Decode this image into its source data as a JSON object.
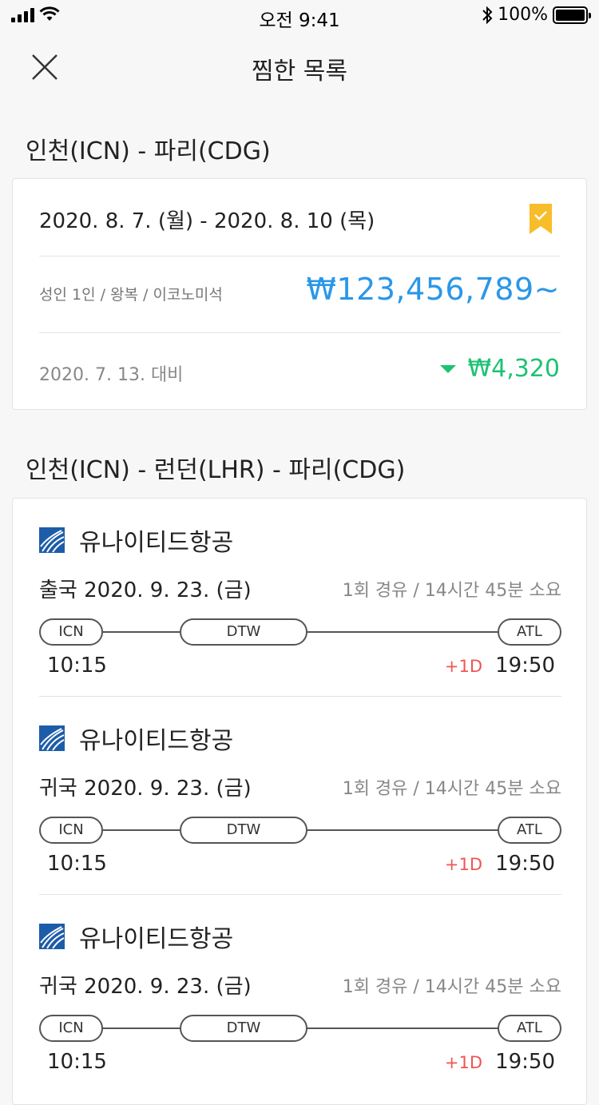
{
  "status_bar": {
    "time": "오전 9:41",
    "battery": "100%"
  },
  "header": {
    "title": "찜한 목록",
    "close_icon": "close-icon"
  },
  "colors": {
    "price_blue": "#2a97e8",
    "drop_green": "#1ec273",
    "bookmark_yellow": "#f7bd2a",
    "plus_day_red": "#f05454",
    "airline_blue": "#1d5ca8"
  },
  "trip1": {
    "route": "인천(ICN) - 파리(CDG)",
    "dates": "2020. 8. 7. (월) - 2020. 8. 10 (목)",
    "passengers": "성인 1인 / 왕복 / 이코노미석",
    "price": "₩123,456,789~",
    "compare_date": "2020. 7. 13. 대비",
    "price_drop": "₩4,320",
    "bookmark_icon": "bookmark-check-icon"
  },
  "trip2": {
    "route": "인천(ICN) - 런던(LHR) - 파리(CDG)",
    "flights": [
      {
        "airline": "유나이티드항공",
        "leg": "출국 2020. 9. 23. (금)",
        "meta": "1회 경유 / 14시간 45분 소요",
        "from": "ICN",
        "via": "DTW",
        "to": "ATL",
        "dep_time": "10:15",
        "plus_day": "+1D",
        "arr_time": "19:50"
      },
      {
        "airline": "유나이티드항공",
        "leg": "귀국 2020. 9. 23. (금)",
        "meta": "1회 경유 / 14시간 45분 소요",
        "from": "ICN",
        "via": "DTW",
        "to": "ATL",
        "dep_time": "10:15",
        "plus_day": "+1D",
        "arr_time": "19:50"
      },
      {
        "airline": "유나이티드항공",
        "leg": "귀국 2020. 9. 23. (금)",
        "meta": "1회 경유 / 14시간 45분 소요",
        "from": "ICN",
        "via": "DTW",
        "to": "ATL",
        "dep_time": "10:15",
        "plus_day": "+1D",
        "arr_time": "19:50"
      }
    ]
  }
}
